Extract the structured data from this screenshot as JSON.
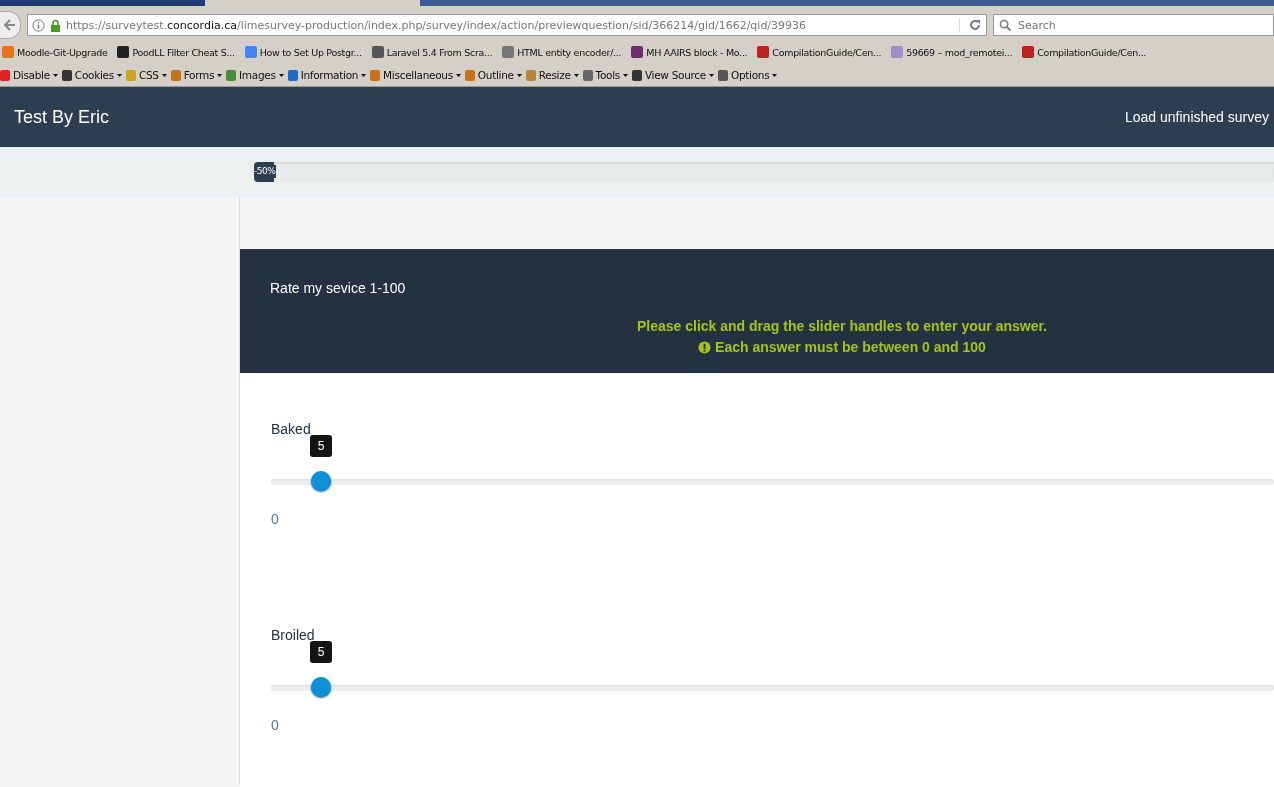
{
  "browser": {
    "url_prefix": "https://surveytest.",
    "url_domain": "concordia.ca",
    "url_path": "/limesurvey-production/index.php/survey/index/action/previewquestion/sid/366214/gid/1662/qid/39936",
    "search": {
      "placeholder": "Search"
    },
    "bookmarks": [
      "Moodle-Git-Upgrade",
      "PoodLL Filter Cheat S...",
      "How to Set Up Postgr...",
      "Laravel 5.4 From Scra...",
      "HTML entity encoder/...",
      "MH AAIRS block - Mo...",
      "CompilationGuide/Cen...",
      "59669 – mod_remotei...",
      "CompilationGuide/Cen..."
    ],
    "toolbar": [
      "Disable",
      "Cookies",
      "CSS",
      "Forms",
      "Images",
      "Information",
      "Miscellaneous",
      "Outline",
      "Resize",
      "Tools",
      "View Source",
      "Options"
    ]
  },
  "navbar": {
    "title": "Test By Eric",
    "link": "Load unfinished survey"
  },
  "progress": {
    "label": "-50%",
    "level": 0.02
  },
  "question": {
    "text": "Rate my sevice 1-100",
    "hint": "Please click and drag the slider handles to enter your answer.",
    "warning": "Each answer must be between 0 and 100",
    "sliders": [
      {
        "label": "Baked",
        "tooltip": "5",
        "level": 0.05,
        "min_label": "0"
      },
      {
        "label": "Broiled",
        "tooltip": "5",
        "level": 0.05,
        "min_label": "0"
      }
    ]
  }
}
